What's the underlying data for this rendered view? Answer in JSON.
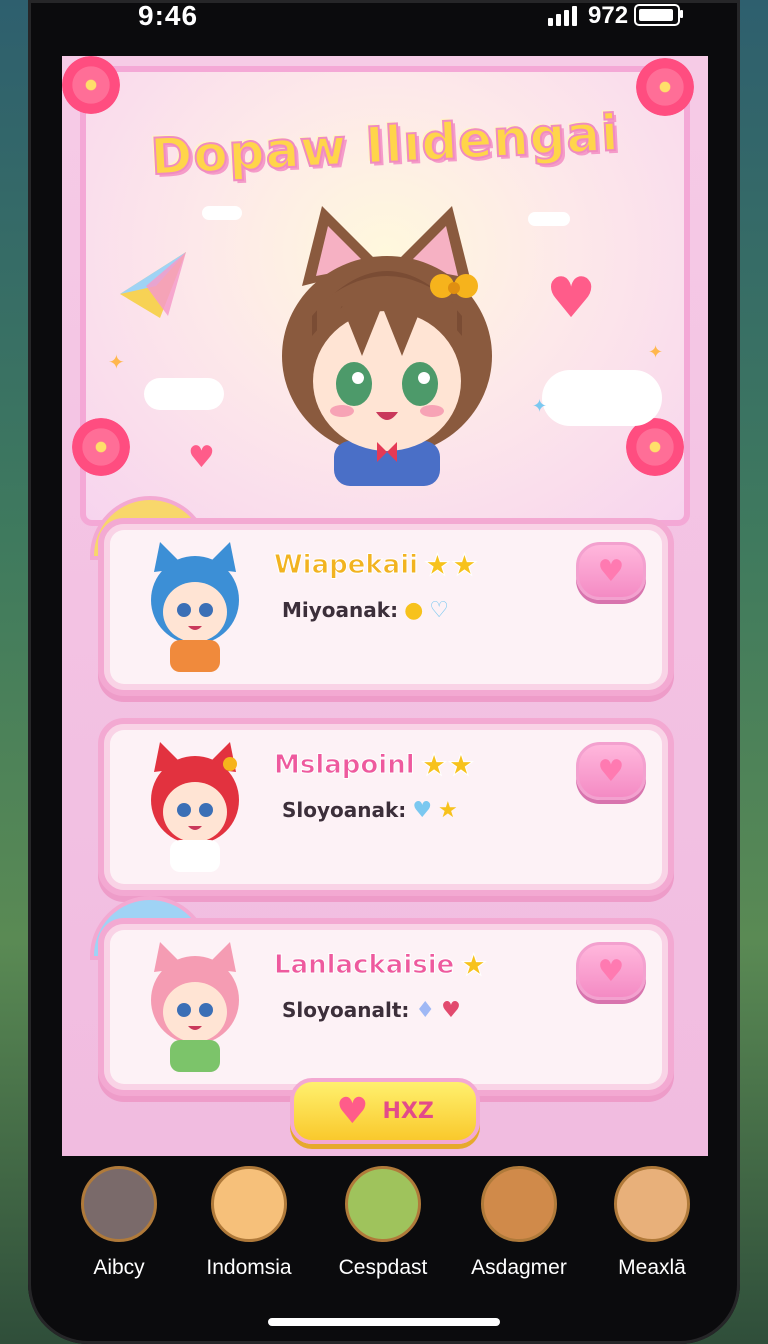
{
  "status": {
    "time": "9:46",
    "battery_text": "972"
  },
  "app": {
    "title": "Dopaw Ilıdengai"
  },
  "cards": [
    {
      "name": "Wiapekaii",
      "sub": "Miyoanak:",
      "name_color": "#f2b320",
      "hair": "#3c8fd6",
      "shirt": "#f08a3c"
    },
    {
      "name": "Mslapoinl",
      "sub": "Sloyoanak:",
      "name_color": "#ee5a9e",
      "hair": "#e2323f",
      "shirt": "#ffffff"
    },
    {
      "name": "Lanlackaisie",
      "sub": "Sloyoanalt:",
      "name_color": "#ee5a9e",
      "hair": "#f59cb3",
      "shirt": "#7cc46a"
    }
  ],
  "cta": {
    "label": "HXZ"
  },
  "tabs": [
    {
      "label": "Aibcy",
      "color": "#7a6a6a"
    },
    {
      "label": "Indomsia",
      "color": "#f6c07a"
    },
    {
      "label": "Cespdast",
      "color": "#9fc35c"
    },
    {
      "label": "Asdagmer",
      "color": "#d08a4a"
    },
    {
      "label": "Meaxlā",
      "color": "#e8b07a"
    }
  ]
}
